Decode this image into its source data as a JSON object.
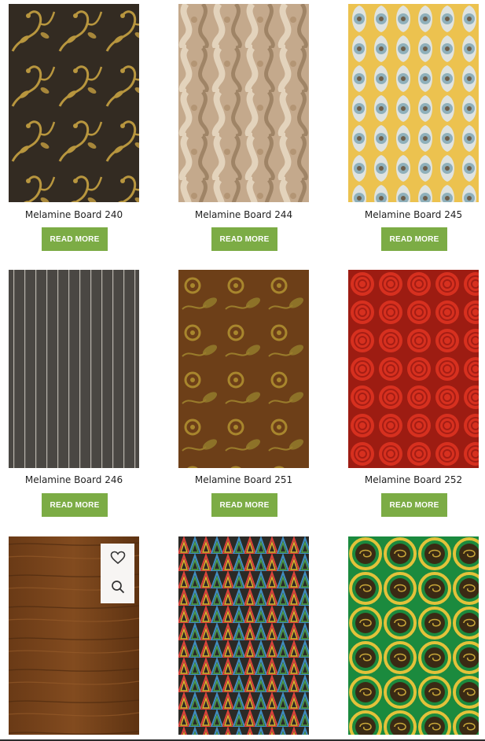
{
  "products": [
    {
      "name": "Melamine Board 240",
      "button": "READ MORE",
      "pattern": "gold-vine-on-dark"
    },
    {
      "name": "Melamine Board 244",
      "button": "READ MORE",
      "pattern": "beige-wave-marble"
    },
    {
      "name": "Melamine Board 245",
      "button": "READ MORE",
      "pattern": "blue-gold-damask"
    },
    {
      "name": "Melamine Board 246",
      "button": "READ MORE",
      "pattern": "gray-pinstripe"
    },
    {
      "name": "Melamine Board 251",
      "button": "READ MORE",
      "pattern": "brown-gold-floral"
    },
    {
      "name": "Melamine Board 252",
      "button": "READ MORE",
      "pattern": "red-roses"
    },
    {
      "pattern": "walnut-woodgrain"
    },
    {
      "pattern": "multicolor-triangles"
    },
    {
      "pattern": "green-gold-medallions"
    }
  ],
  "quick_actions": {
    "wishlist": "heart-icon",
    "quick_view": "search-icon"
  },
  "colors": {
    "button": "#7cac45",
    "button_text": "#ffffff",
    "title_text": "#222222"
  }
}
